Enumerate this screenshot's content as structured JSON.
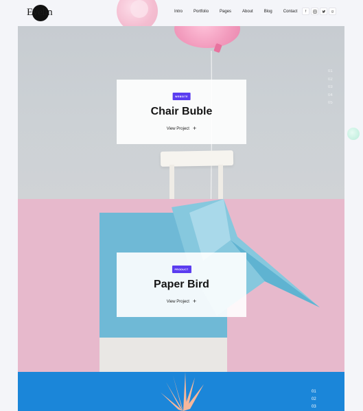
{
  "header": {
    "logo": "Evelin",
    "nav": [
      "Intro",
      "Portfolio",
      "Pages",
      "About",
      "Blog",
      "Contact"
    ],
    "socials": [
      "facebook-icon",
      "instagram-icon",
      "twitter-icon",
      "google-plus-icon"
    ]
  },
  "projects": [
    {
      "tag": "WEBSITE",
      "title": "Chair Buble",
      "link": "View Project"
    },
    {
      "tag": "PRODUCT",
      "title": "Paper Bird",
      "link": "View Project"
    }
  ],
  "slide_indicator": {
    "numbers": [
      "01",
      "02",
      "03",
      "04",
      "05"
    ]
  },
  "slide_indicator_bottom": {
    "numbers": [
      "01",
      "02",
      "03"
    ]
  },
  "colors": {
    "accent": "#5a3cf0",
    "panel_gray": "#c9cdd1",
    "panel_pink": "#e7b9cc",
    "panel_blue": "#1b86d9"
  }
}
